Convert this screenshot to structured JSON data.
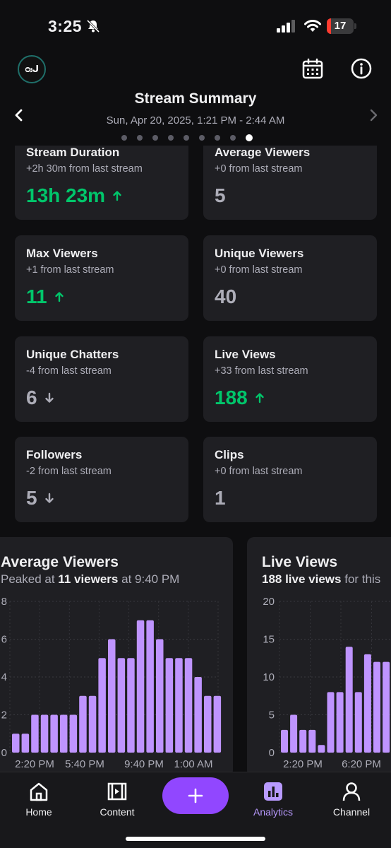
{
  "status_bar": {
    "time": "3:25",
    "battery": "17",
    "battery_level": 0.17
  },
  "header": {
    "logo_text": "ᴑ᎓ᒍ",
    "title": "Stream Summary",
    "subtitle": "Sun, Apr 20, 2025, 1:21 PM - 2:44 AM",
    "page_dots": 9,
    "active_dot": 8
  },
  "stats": [
    {
      "label": "Stream Duration",
      "delta": "+2h 30m from last stream",
      "value": "13h 23m",
      "trend": "up"
    },
    {
      "label": "Average Viewers",
      "delta": "+0 from last stream",
      "value": "5",
      "trend": "flat"
    },
    {
      "label": "Max Viewers",
      "delta": "+1 from last stream",
      "value": "11",
      "trend": "up"
    },
    {
      "label": "Unique Viewers",
      "delta": "+0 from last stream",
      "value": "40",
      "trend": "flat"
    },
    {
      "label": "Unique Chatters",
      "delta": "-4 from last stream",
      "value": "6",
      "trend": "down"
    },
    {
      "label": "Live Views",
      "delta": "+33 from last stream",
      "value": "188",
      "trend": "up"
    },
    {
      "label": "Followers",
      "delta": "-2 from last stream",
      "value": "5",
      "trend": "down"
    },
    {
      "label": "Clips",
      "delta": "+0 from last stream",
      "value": "1",
      "trend": "flat"
    }
  ],
  "charts": {
    "avg_viewers": {
      "title": "Average Viewers",
      "sub_prefix": "Peaked at",
      "sub_bold": "11 viewers",
      "sub_suffix": "at 9:40 PM"
    },
    "live_views": {
      "title": "Live Views",
      "sub_bold": "188 live views",
      "sub_suffix": "for this"
    }
  },
  "chart_data": [
    {
      "type": "bar",
      "title": "Average Viewers",
      "ylim": [
        0,
        8
      ],
      "yticks": [
        "8",
        "6",
        "4",
        "2",
        "0"
      ],
      "xticks": [
        "2:20 PM",
        "5:40 PM",
        "9:40 PM",
        "1:00 AM"
      ],
      "values": [
        1,
        1,
        2,
        2,
        2,
        2,
        2,
        3,
        3,
        5,
        6,
        5,
        5,
        7,
        7,
        6,
        5,
        5,
        5,
        4,
        3,
        3
      ],
      "color": "#bf94ff",
      "grid": true
    },
    {
      "type": "bar",
      "title": "Live Views",
      "ylim": [
        0,
        20
      ],
      "yticks": [
        "20",
        "15",
        "10",
        "5",
        "0"
      ],
      "xticks": [
        "2:20 PM",
        "6:20 PM"
      ],
      "values": [
        3,
        5,
        3,
        3,
        1,
        8,
        8,
        14,
        8,
        13,
        12,
        12
      ],
      "color": "#bf94ff",
      "grid": true
    }
  ],
  "tabs": [
    {
      "label": "Home",
      "icon": "home-icon"
    },
    {
      "label": "Content",
      "icon": "content-icon"
    },
    {
      "label": "Analytics",
      "icon": "analytics-icon",
      "active": true
    },
    {
      "label": "Channel",
      "icon": "channel-icon"
    }
  ],
  "colors": {
    "accent": "#9147ff",
    "up": "#00c66b",
    "bar": "#bf94ff",
    "card": "#1f1f23"
  }
}
